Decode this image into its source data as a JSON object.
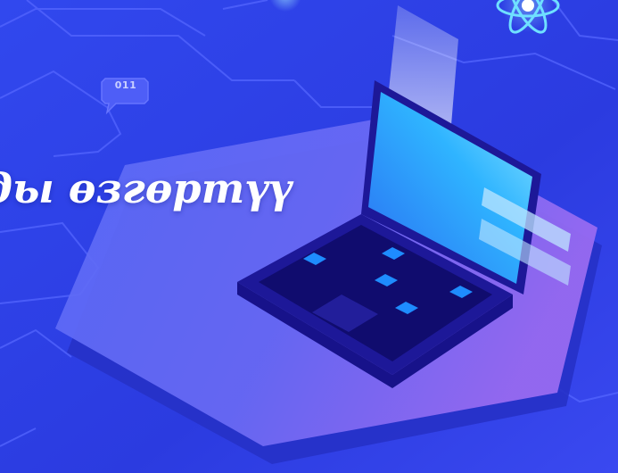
{
  "headline": "ды өзгөртүү",
  "binary_badge": "011",
  "icons": {
    "binary_badge": "binary-speech-bubble-icon",
    "atom": "atom-icon",
    "laptop": "laptop-illustration"
  },
  "colors": {
    "background": "#2f3fe8",
    "platform": "#5b64f5",
    "platform_shadow": "#2a33c8",
    "laptop_body": "#1a1690",
    "laptop_screen": "#2fb8ff",
    "keys": "#1e88ff",
    "text": "#ffffff"
  }
}
